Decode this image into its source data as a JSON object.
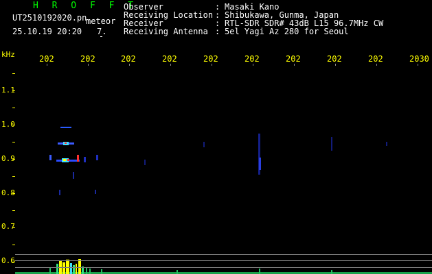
{
  "header": {
    "app_title": "H R O F F T",
    "file_name": "UT2510192020.pn",
    "meteor_label": "meteor",
    "datetime": "25.10.19 20:20",
    "meteor_count": "7."
  },
  "info": [
    {
      "key": "Observer",
      "sep": ":",
      "value": "Masaki Kano"
    },
    {
      "key": "Receiving Location",
      "sep": ":",
      "value": "Shibukawa, Gunma, Japan"
    },
    {
      "key": "Receiver",
      "sep": ":",
      "value": "RTL-SDR SDR# 43dB L15 96.7MHz CW"
    },
    {
      "key": "Receiving Antenna",
      "sep": ":",
      "value": "5el Yagi Az 280 for Seoul"
    }
  ],
  "axis": {
    "freq_unit": "kHz",
    "freq_labels": [
      "1.1",
      "1.0",
      "0.9",
      "0.8",
      "0.7",
      "0.6"
    ],
    "time_labels": [
      "202",
      "202",
      "202",
      "202",
      "202",
      "202",
      "202",
      "202",
      "202",
      "2030"
    ]
  },
  "colors": {
    "title": "#00ff00",
    "text": "#ffffff",
    "axis_label": "#ffff00",
    "background": "#000000",
    "signal_blue": "#3b5bff",
    "signal_red": "#ff3030",
    "signal_yellow": "#ffff00",
    "signal_cyan": "#40e0ff"
  }
}
